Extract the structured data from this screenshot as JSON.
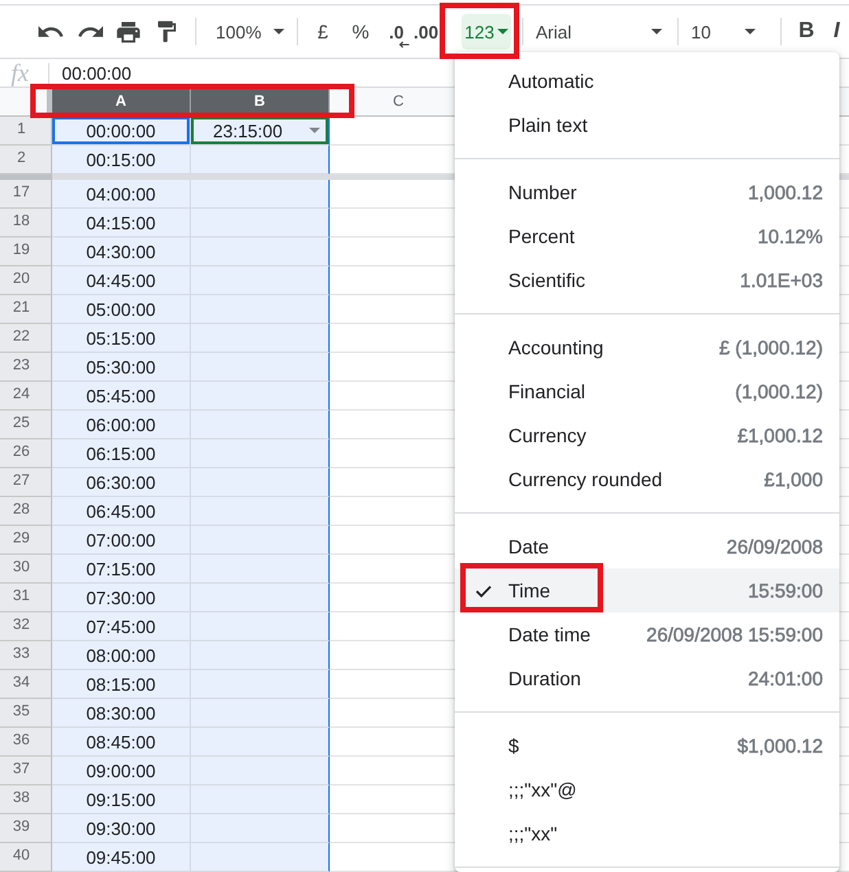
{
  "toolbar": {
    "zoom": "100%",
    "currency": "£",
    "percent": "%",
    "decrease_decimals": ".0",
    "increase_decimals": ".00",
    "format_button": {
      "label": "123",
      "open": true,
      "annotated": true
    },
    "font": "Arial",
    "font_size": "10",
    "bold": "B",
    "italic": "I"
  },
  "formula_bar": {
    "icon_text": "fx",
    "value": "00:00:00"
  },
  "grid": {
    "columns": [
      {
        "label": "A",
        "selected": true
      },
      {
        "label": "B",
        "selected": true
      },
      {
        "label": "C",
        "selected": false
      }
    ],
    "columns_annotated": true,
    "frozen_rows": [
      {
        "number": "1",
        "cells": [
          {
            "value": "00:00:00",
            "active": true,
            "dropdown": false
          },
          {
            "value": "23:15:00",
            "active": false,
            "dropdown": true,
            "color": "#188038"
          }
        ]
      },
      {
        "number": "2",
        "cells": [
          {
            "value": "00:15:00"
          }
        ]
      }
    ],
    "rows": [
      {
        "number": "17",
        "cells": [
          {
            "value": "04:00:00"
          }
        ]
      },
      {
        "number": "18",
        "cells": [
          {
            "value": "04:15:00"
          }
        ]
      },
      {
        "number": "19",
        "cells": [
          {
            "value": "04:30:00"
          }
        ]
      },
      {
        "number": "20",
        "cells": [
          {
            "value": "04:45:00"
          }
        ]
      },
      {
        "number": "21",
        "cells": [
          {
            "value": "05:00:00"
          }
        ]
      },
      {
        "number": "22",
        "cells": [
          {
            "value": "05:15:00"
          }
        ]
      },
      {
        "number": "23",
        "cells": [
          {
            "value": "05:30:00"
          }
        ]
      },
      {
        "number": "24",
        "cells": [
          {
            "value": "05:45:00"
          }
        ]
      },
      {
        "number": "25",
        "cells": [
          {
            "value": "06:00:00"
          }
        ]
      },
      {
        "number": "26",
        "cells": [
          {
            "value": "06:15:00"
          }
        ]
      },
      {
        "number": "27",
        "cells": [
          {
            "value": "06:30:00"
          }
        ]
      },
      {
        "number": "28",
        "cells": [
          {
            "value": "06:45:00"
          }
        ]
      },
      {
        "number": "29",
        "cells": [
          {
            "value": "07:00:00"
          }
        ]
      },
      {
        "number": "30",
        "cells": [
          {
            "value": "07:15:00"
          }
        ]
      },
      {
        "number": "31",
        "cells": [
          {
            "value": "07:30:00"
          }
        ]
      },
      {
        "number": "32",
        "cells": [
          {
            "value": "07:45:00"
          }
        ]
      },
      {
        "number": "33",
        "cells": [
          {
            "value": "08:00:00"
          }
        ]
      },
      {
        "number": "34",
        "cells": [
          {
            "value": "08:15:00"
          }
        ]
      },
      {
        "number": "35",
        "cells": [
          {
            "value": "08:30:00"
          }
        ]
      },
      {
        "number": "36",
        "cells": [
          {
            "value": "08:45:00"
          }
        ]
      },
      {
        "number": "37",
        "cells": [
          {
            "value": "09:00:00"
          }
        ]
      },
      {
        "number": "38",
        "cells": [
          {
            "value": "09:15:00"
          }
        ]
      },
      {
        "number": "39",
        "cells": [
          {
            "value": "09:30:00"
          }
        ]
      },
      {
        "number": "40",
        "cells": [
          {
            "value": "09:45:00"
          }
        ]
      }
    ]
  },
  "format_menu": {
    "groups": [
      {
        "items": [
          {
            "label": "Automatic",
            "selected": false,
            "annotated": false
          },
          {
            "label": "Plain text",
            "selected": false,
            "annotated": false
          }
        ]
      },
      {
        "items": [
          {
            "label": "Number",
            "example": "1,000.12",
            "selected": false,
            "annotated": false
          },
          {
            "label": "Percent",
            "example": "10.12%",
            "selected": false,
            "annotated": false
          },
          {
            "label": "Scientific",
            "example": "1.01E+03",
            "selected": false,
            "annotated": false
          }
        ]
      },
      {
        "items": [
          {
            "label": "Accounting",
            "example": "£ (1,000.12)",
            "selected": false,
            "annotated": false
          },
          {
            "label": "Financial",
            "example": "(1,000.12)",
            "selected": false,
            "annotated": false
          },
          {
            "label": "Currency",
            "example": "£1,000.12",
            "selected": false,
            "annotated": false
          },
          {
            "label": "Currency rounded",
            "example": "£1,000",
            "selected": false,
            "annotated": false
          }
        ]
      },
      {
        "items": [
          {
            "label": "Date",
            "example": "26/09/2008",
            "selected": false,
            "annotated": false
          },
          {
            "label": "Time",
            "example": "15:59:00",
            "selected": true,
            "annotated": true
          },
          {
            "label": "Date time",
            "example": "26/09/2008 15:59:00",
            "selected": false,
            "annotated": false
          },
          {
            "label": "Duration",
            "example": "24:01:00",
            "selected": false,
            "annotated": false
          }
        ]
      },
      {
        "items": [
          {
            "label": "$",
            "example": "$1,000.12",
            "selected": false,
            "annotated": false
          },
          {
            "label": ";;;\"xx\"@",
            "selected": false,
            "annotated": false
          },
          {
            "label": ";;;\"xx\"",
            "selected": false,
            "annotated": false
          }
        ]
      }
    ]
  }
}
